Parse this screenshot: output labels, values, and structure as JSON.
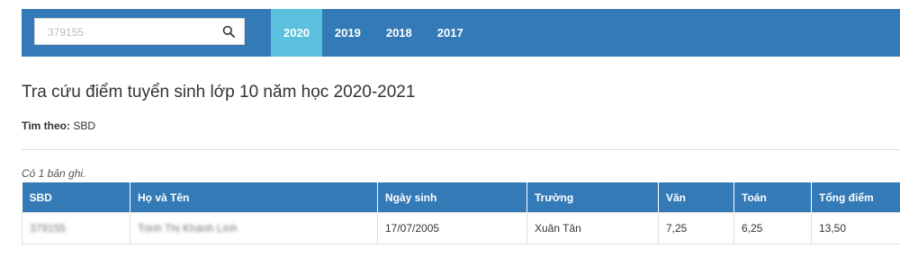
{
  "search": {
    "value": "379155"
  },
  "tabs": [
    {
      "label": "2020",
      "active": true
    },
    {
      "label": "2019",
      "active": false
    },
    {
      "label": "2018",
      "active": false
    },
    {
      "label": "2017",
      "active": false
    }
  ],
  "page": {
    "title": "Tra cứu điểm tuyển sinh lớp 10 năm học 2020-2021",
    "search_by_label": "Tìm theo:",
    "search_by_value": "SBD",
    "record_count": "Có 1 bản ghi."
  },
  "table": {
    "headers": [
      "SBD",
      "Họ và Tên",
      "Ngày sinh",
      "Trường",
      "Văn",
      "Toán",
      "Tổng điểm"
    ],
    "rows": [
      [
        "379155",
        "Trịnh Thị Khánh Linh",
        "17/07/2005",
        "Xuân Tân",
        "7,25",
        "6,25",
        "13,50"
      ]
    ]
  },
  "colors": {
    "navbar": "#337ab7",
    "active_tab": "#5bc0de"
  }
}
